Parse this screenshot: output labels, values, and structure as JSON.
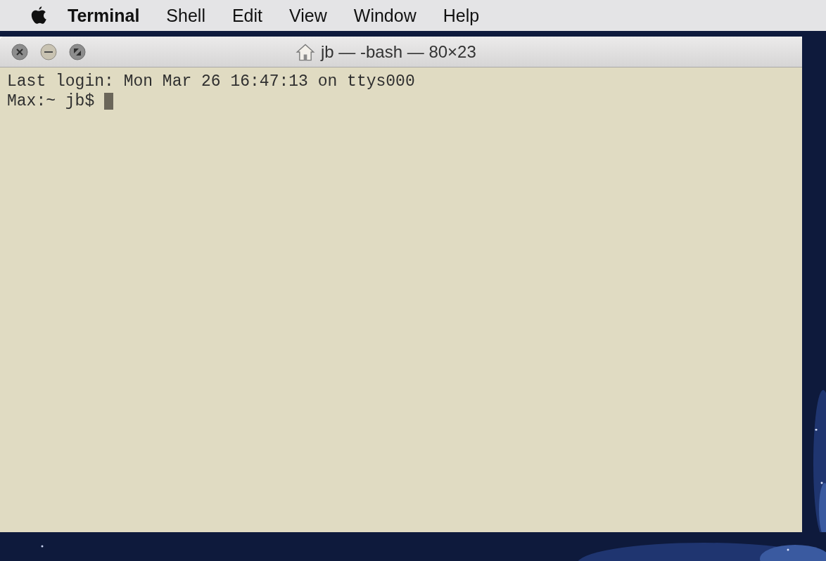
{
  "menu_bar": {
    "app_name": "Terminal",
    "items": [
      "Shell",
      "Edit",
      "View",
      "Window",
      "Help"
    ]
  },
  "window": {
    "title": "jb — -bash — 80×23",
    "lines": [
      "Last login: Mon Mar 26 16:47:13 on ttys000",
      "Max:~ jb$ "
    ]
  }
}
